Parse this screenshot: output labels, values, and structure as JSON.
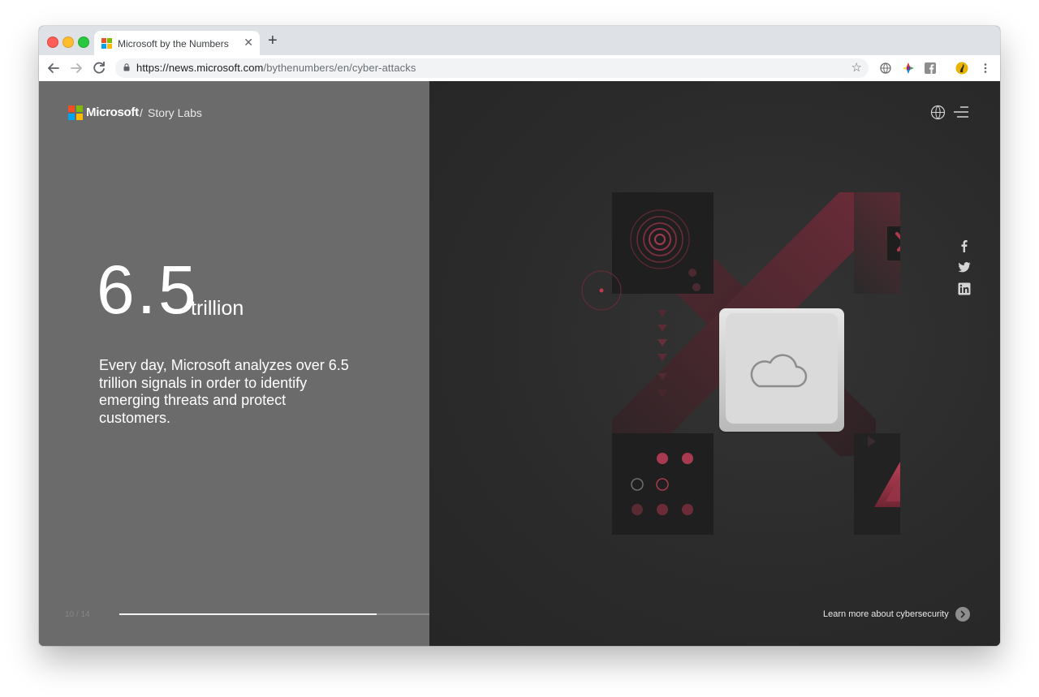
{
  "browser": {
    "tab_title": "Microsoft by the Numbers",
    "tab_close": "✕",
    "new_tab": "+",
    "url_host": "https://news.microsoft.com",
    "url_path": "/bythenumbers/en/cyber-attacks"
  },
  "header": {
    "brand": "Microsoft",
    "separator": "/",
    "section": "Story Labs"
  },
  "stat": {
    "number": "6.5",
    "unit": "trillion",
    "description": "Every day, Microsoft analyzes over 6.5 trillion signals in order to identify emerging threats and protect customers."
  },
  "pager": {
    "label": "10 / 14",
    "progress": 0.69
  },
  "footer": {
    "learn_more": "Learn more about cybersecurity"
  },
  "colors": {
    "left_panel": "#6b6b6b",
    "right_panel": "#2b2b2b",
    "accent": "#c0394f"
  },
  "icons": [
    "back-icon",
    "forward-icon",
    "reload-icon",
    "lock-icon",
    "star-icon",
    "globe-icon",
    "menu-icon",
    "facebook-icon",
    "twitter-icon",
    "linkedin-icon",
    "cloud-icon",
    "chevron-right-icon"
  ]
}
